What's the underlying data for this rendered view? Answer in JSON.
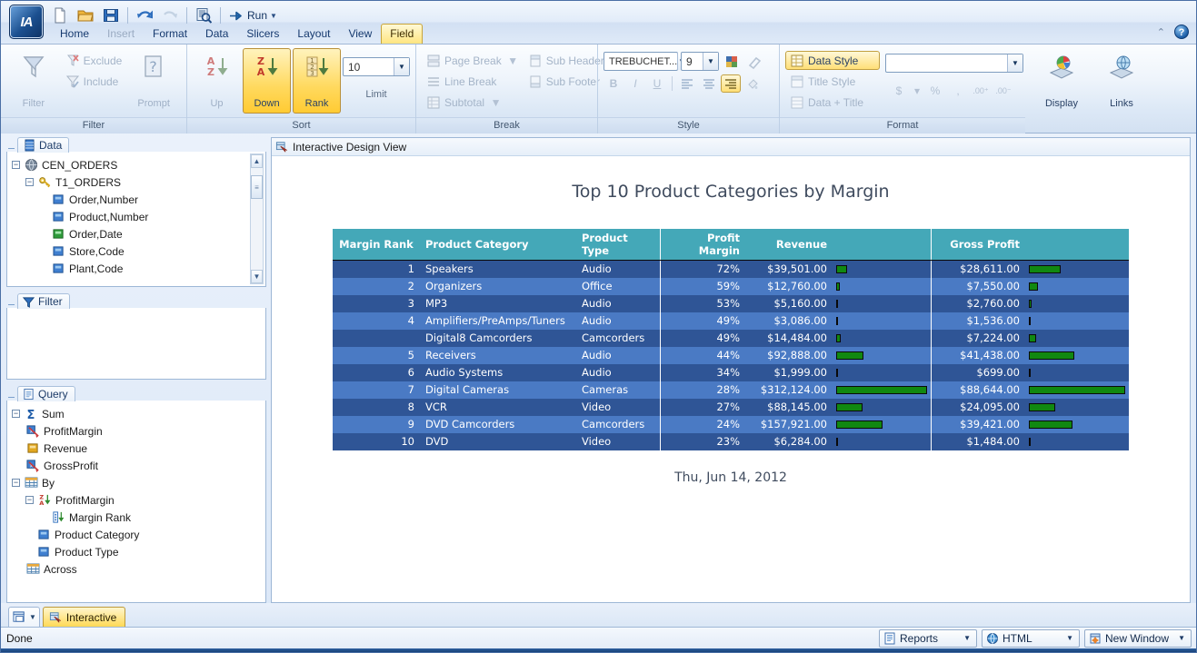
{
  "window": {
    "logo_text": "IA"
  },
  "quick_access": {
    "items": [
      {
        "name": "new-document",
        "label": "New"
      },
      {
        "name": "open-folder",
        "label": "Open"
      },
      {
        "name": "save",
        "label": "Save"
      },
      {
        "name": "undo",
        "label": "Undo"
      },
      {
        "name": "redo",
        "label": "Redo"
      },
      {
        "name": "preview",
        "label": "Preview"
      }
    ],
    "run_label": "Run"
  },
  "ribbon_tabs": [
    {
      "label": "Home",
      "state": "normal"
    },
    {
      "label": "Insert",
      "state": "disabled"
    },
    {
      "label": "Format",
      "state": "normal"
    },
    {
      "label": "Data",
      "state": "normal"
    },
    {
      "label": "Slicers",
      "state": "normal"
    },
    {
      "label": "Layout",
      "state": "normal"
    },
    {
      "label": "View",
      "state": "normal"
    },
    {
      "label": "Field",
      "state": "active"
    }
  ],
  "ribbon": {
    "groups": [
      {
        "title": "Filter",
        "big": [
          {
            "label": "Filter",
            "icon": "funnel-icon",
            "state": "disabled"
          },
          {
            "label": "Prompt",
            "icon": "prompt-icon",
            "state": "disabled"
          }
        ],
        "small": [
          {
            "label": "Exclude",
            "icon": "exclude-icon",
            "state": "disabled"
          },
          {
            "label": "Include",
            "icon": "include-icon",
            "state": "disabled"
          }
        ]
      },
      {
        "title": "Sort",
        "big": [
          {
            "label": "Up",
            "icon": "sort-az-icon",
            "state": "disabled"
          },
          {
            "label": "Down",
            "icon": "sort-za-icon",
            "state": "selected"
          },
          {
            "label": "Rank",
            "icon": "rank-icon",
            "state": "selected"
          }
        ],
        "limit_label": "Limit",
        "limit_value": "10"
      },
      {
        "title": "Break",
        "small": [
          {
            "label": "Page Break",
            "icon": "page-break-icon",
            "state": "disabled",
            "split": true
          },
          {
            "label": "Line Break",
            "icon": "line-break-icon",
            "state": "disabled"
          },
          {
            "label": "Subtotal",
            "icon": "subtotal-icon",
            "state": "disabled",
            "split": true
          }
        ],
        "small2": [
          {
            "label": "Sub Header",
            "icon": "sub-header-icon",
            "state": "disabled"
          },
          {
            "label": "Sub Footer",
            "icon": "sub-footer-icon",
            "state": "disabled"
          }
        ]
      },
      {
        "title": "Style",
        "font_name": "TREBUCHET...",
        "font_size": "9",
        "bold": "B",
        "italic": "I",
        "underline": "U"
      },
      {
        "title": "Format",
        "style_targets": [
          {
            "label": "Data Style",
            "state": "selected"
          },
          {
            "label": "Title Style",
            "state": "disabled"
          },
          {
            "label": "Data + Title",
            "state": "disabled"
          }
        ],
        "format_value": "",
        "big": [
          {
            "label": "Display",
            "icon": "display-icon",
            "state": "normal"
          },
          {
            "label": "Links",
            "icon": "links-icon",
            "state": "normal"
          }
        ]
      }
    ]
  },
  "panels": {
    "data": {
      "title": "Data",
      "tree": [
        {
          "label": "CEN_ORDERS",
          "depth": 0,
          "expander": "-",
          "icon": "database-icon"
        },
        {
          "label": "T1_ORDERS",
          "depth": 1,
          "expander": "-",
          "icon": "table-key-icon"
        },
        {
          "label": "Order,Number",
          "depth": 2,
          "expander": "",
          "icon": "field-blue-icon"
        },
        {
          "label": "Product,Number",
          "depth": 2,
          "expander": "",
          "icon": "field-blue-icon"
        },
        {
          "label": "Order,Date",
          "depth": 2,
          "expander": "",
          "icon": "field-green-icon"
        },
        {
          "label": "Store,Code",
          "depth": 2,
          "expander": "",
          "icon": "field-blue-icon"
        },
        {
          "label": "Plant,Code",
          "depth": 2,
          "expander": "",
          "icon": "field-blue-icon"
        }
      ]
    },
    "filter": {
      "title": "Filter",
      "items": []
    },
    "query": {
      "title": "Query",
      "tree": [
        {
          "label": "Sum",
          "depth": 0,
          "expander": "-",
          "icon": "sigma-icon"
        },
        {
          "label": "ProfitMargin",
          "depth": 1,
          "expander": "",
          "icon": "calc-field-icon"
        },
        {
          "label": "Revenue",
          "depth": 1,
          "expander": "",
          "icon": "field-yellow-icon"
        },
        {
          "label": "GrossProfit",
          "depth": 1,
          "expander": "",
          "icon": "calc-field-icon"
        },
        {
          "label": "By",
          "depth": 0,
          "expander": "-",
          "icon": "grid-icon"
        },
        {
          "label": "ProfitMargin",
          "depth": 1,
          "expander": "-",
          "icon": "sort-za-small-icon"
        },
        {
          "label": "Margin Rank",
          "depth": 2,
          "expander": "",
          "icon": "rank-small-icon"
        },
        {
          "label": "Product Category",
          "depth": 1,
          "expander": "",
          "icon": "field-blue-icon"
        },
        {
          "label": "Product Type",
          "depth": 1,
          "expander": "",
          "icon": "field-blue-icon"
        },
        {
          "label": "Across",
          "depth": 0,
          "expander": "",
          "icon": "grid-icon"
        }
      ]
    }
  },
  "canvas": {
    "header_title": "Interactive Design View",
    "header_icon": "design-view-icon"
  },
  "report": {
    "title": "Top 10 Product Categories by Margin",
    "date": "Thu, Jun 14, 2012",
    "columns": [
      "Margin Rank",
      "Product Category",
      "Product Type",
      "Profit Margin",
      "Revenue",
      "",
      "Gross Profit",
      ""
    ],
    "rows": [
      {
        "rank": "1",
        "category": "Speakers",
        "type": "Audio",
        "margin": "72%",
        "revenue": "$39,501.00",
        "revenue_bar": 12,
        "gross": "$28,611.00",
        "gross_bar": 33
      },
      {
        "rank": "2",
        "category": "Organizers",
        "type": "Office",
        "margin": "59%",
        "revenue": "$12,760.00",
        "revenue_bar": 4,
        "gross": "$7,550.00",
        "gross_bar": 9
      },
      {
        "rank": "3",
        "category": "MP3",
        "type": "Audio",
        "margin": "53%",
        "revenue": "$5,160.00",
        "revenue_bar": 2,
        "gross": "$2,760.00",
        "gross_bar": 3
      },
      {
        "rank": "4",
        "category": "Amplifiers/PreAmps/Tuners",
        "type": "Audio",
        "margin": "49%",
        "revenue": "$3,086.00",
        "revenue_bar": 2,
        "gross": "$1,536.00",
        "gross_bar": 2
      },
      {
        "rank": "",
        "category": "Digital8 Camcorders",
        "type": "Camcorders",
        "margin": "49%",
        "revenue": "$14,484.00",
        "revenue_bar": 5,
        "gross": "$7,224.00",
        "gross_bar": 8
      },
      {
        "rank": "5",
        "category": "Receivers",
        "type": "Audio",
        "margin": "44%",
        "revenue": "$92,888.00",
        "revenue_bar": 30,
        "gross": "$41,438.00",
        "gross_bar": 47
      },
      {
        "rank": "6",
        "category": "Audio Systems",
        "type": "Audio",
        "margin": "34%",
        "revenue": "$1,999.00",
        "revenue_bar": 2,
        "gross": "$699.00",
        "gross_bar": 2
      },
      {
        "rank": "7",
        "category": "Digital Cameras",
        "type": "Cameras",
        "margin": "28%",
        "revenue": "$312,124.00",
        "revenue_bar": 100,
        "gross": "$88,644.00",
        "gross_bar": 100
      },
      {
        "rank": "8",
        "category": "VCR",
        "type": "Video",
        "margin": "27%",
        "revenue": "$88,145.00",
        "revenue_bar": 29,
        "gross": "$24,095.00",
        "gross_bar": 27
      },
      {
        "rank": "9",
        "category": "DVD Camcorders",
        "type": "Camcorders",
        "margin": "24%",
        "revenue": "$157,921.00",
        "revenue_bar": 51,
        "gross": "$39,421.00",
        "gross_bar": 45
      },
      {
        "rank": "10",
        "category": "DVD",
        "type": "Video",
        "margin": "23%",
        "revenue": "$6,284.00",
        "revenue_bar": 2,
        "gross": "$1,484.00",
        "gross_bar": 2
      }
    ],
    "colors": {
      "header_bg": "#44a8b8",
      "row_dark": "#2f5596",
      "row_light": "#4a7ac4",
      "bar": "#118811"
    }
  },
  "chart_data": {
    "type": "table",
    "title": "Top 10 Product Categories by Margin",
    "categories": [
      "Speakers",
      "Organizers",
      "MP3",
      "Amplifiers/PreAmps/Tuners",
      "Digital8 Camcorders",
      "Receivers",
      "Audio Systems",
      "Digital Cameras",
      "VCR",
      "DVD Camcorders",
      "DVD"
    ],
    "series": [
      {
        "name": "Profit Margin",
        "values": [
          72,
          59,
          53,
          49,
          49,
          44,
          34,
          28,
          27,
          24,
          23
        ]
      },
      {
        "name": "Revenue",
        "values": [
          39501,
          12760,
          5160,
          3086,
          14484,
          92888,
          1999,
          312124,
          88145,
          157921,
          6284
        ]
      },
      {
        "name": "Gross Profit",
        "values": [
          28611,
          7550,
          2760,
          1536,
          7224,
          41438,
          699,
          88644,
          24095,
          39421,
          1484
        ]
      }
    ],
    "xlabel": "Product Category",
    "ylabel": ""
  },
  "bottom": {
    "view_button": "view-selector",
    "tab_label": "Interactive",
    "tab_icon": "interactive-icon"
  },
  "status": {
    "message": "Done",
    "dropdowns": [
      {
        "label": "Reports",
        "icon": "reports-icon"
      },
      {
        "label": "HTML",
        "icon": "html-icon"
      },
      {
        "label": "New Window",
        "icon": "new-window-icon"
      }
    ]
  }
}
